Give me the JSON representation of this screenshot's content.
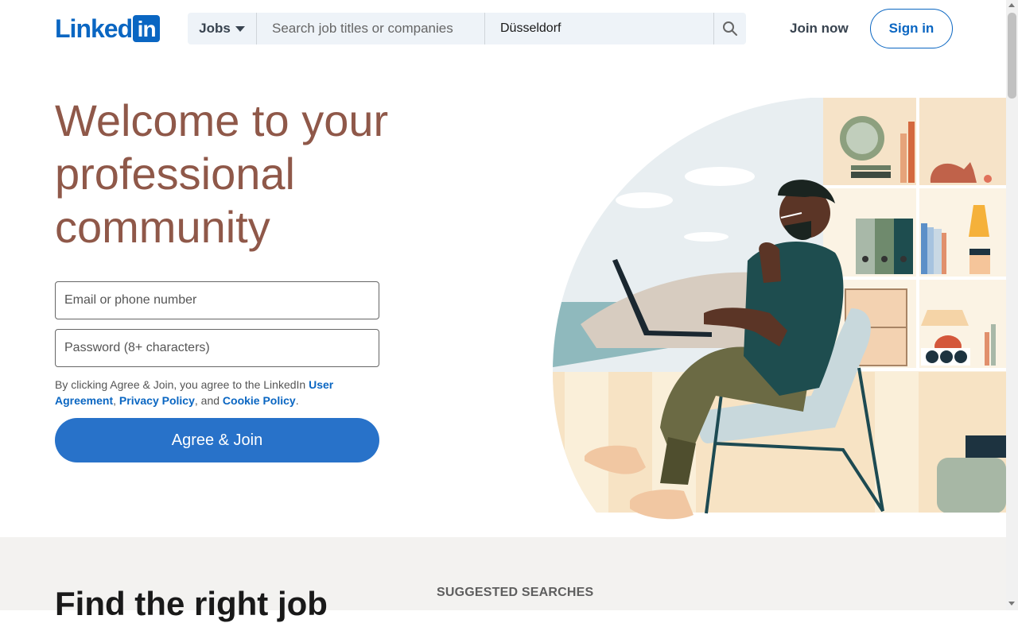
{
  "header": {
    "logo_text": "Linked",
    "logo_in": "in",
    "jobs_select": "Jobs",
    "keywords_placeholder": "Search job titles or companies",
    "location_value": "Düsseldorf",
    "join_now": "Join now",
    "sign_in": "Sign in"
  },
  "hero": {
    "title": "Welcome to your professional community",
    "email_placeholder": "Email or phone number",
    "password_placeholder": "Password (8+ characters)",
    "legal_prefix": "By clicking Agree & Join, you agree to the LinkedIn ",
    "user_agreement": "User Agreement",
    "comma": ", ",
    "privacy_policy": "Privacy Policy",
    "and": ", and ",
    "cookie_policy": "Cookie Policy",
    "period": ".",
    "agree_button": "Agree & Join"
  },
  "lower": {
    "title": "Find the right job",
    "suggested": "SUGGESTED SEARCHES"
  },
  "colors": {
    "brand": "#0a66c2",
    "title": "#8f5849",
    "button": "#2872c9"
  }
}
